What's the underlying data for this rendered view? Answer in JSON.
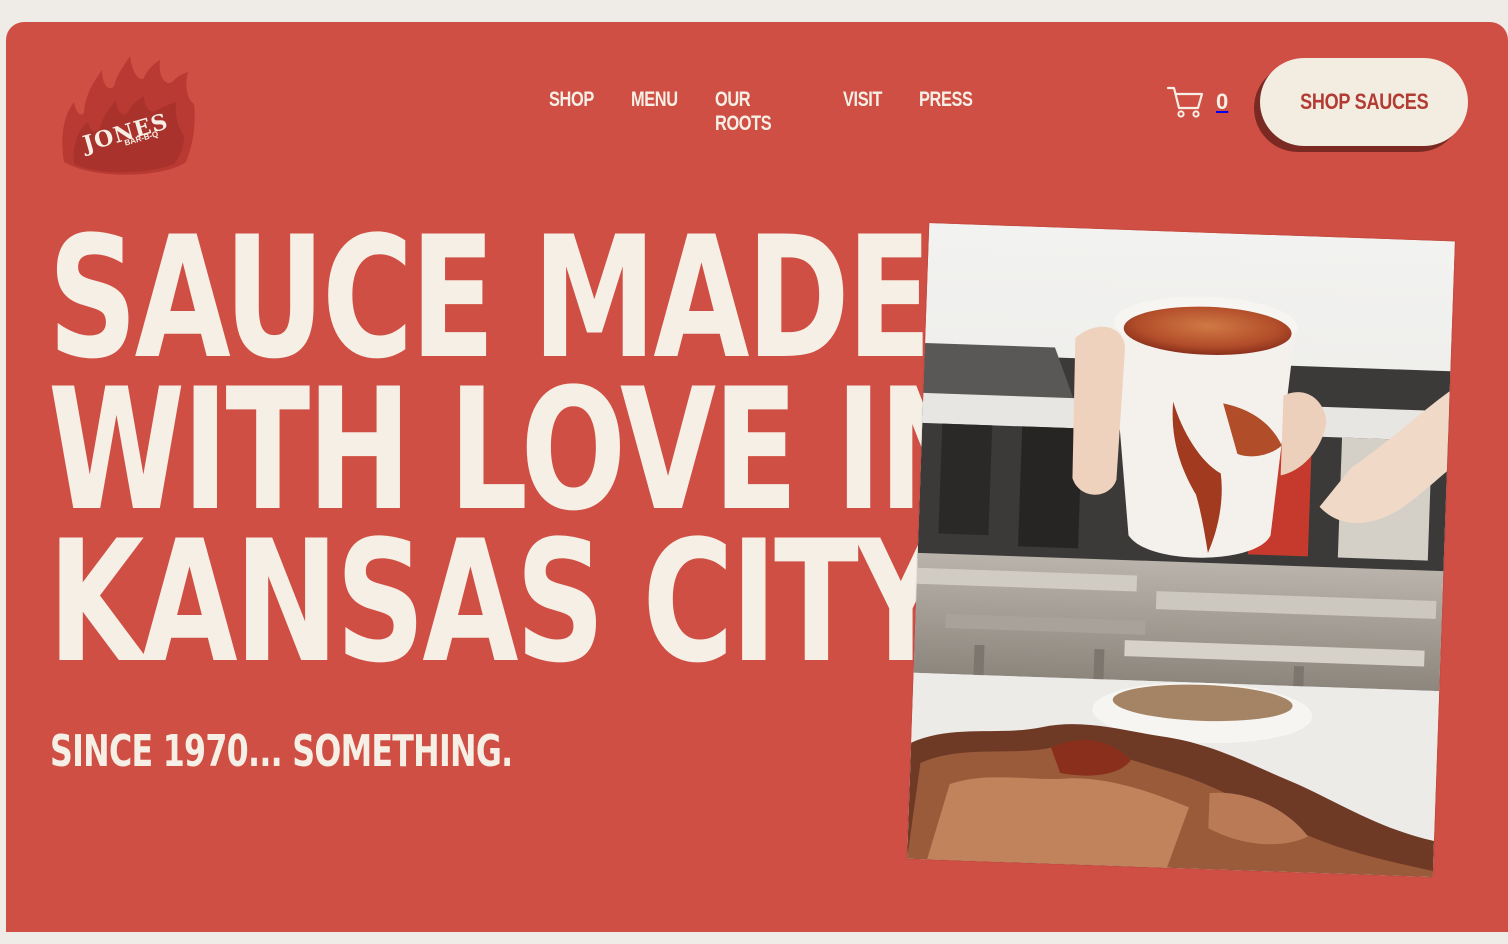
{
  "brand": {
    "logo_main": "JONES",
    "logo_sub": "BAR-B-Q"
  },
  "nav": {
    "items": [
      {
        "label": "SHOP"
      },
      {
        "label": "MENU"
      },
      {
        "label": "OUR ROOTS"
      },
      {
        "label": "VISIT"
      },
      {
        "label": "PRESS"
      }
    ]
  },
  "cart": {
    "icon": "cart-icon",
    "count": "0"
  },
  "cta": {
    "label": "SHOP SAUCES"
  },
  "hero": {
    "headline_lines": [
      "SAUCE MADE",
      "WITH LOVE IN",
      "KANSAS CITY"
    ],
    "tagline": "SINCE 1970... SOMETHING.",
    "image_alt": "Hand holding a cup of barbecue sauce over a plate of burnt ends"
  },
  "colors": {
    "page_background": "#efebe6",
    "brand_red": "#d04f44",
    "cream": "#f5efe5",
    "button_text": "#b23c33",
    "button_shadow": "#7a2a22"
  }
}
